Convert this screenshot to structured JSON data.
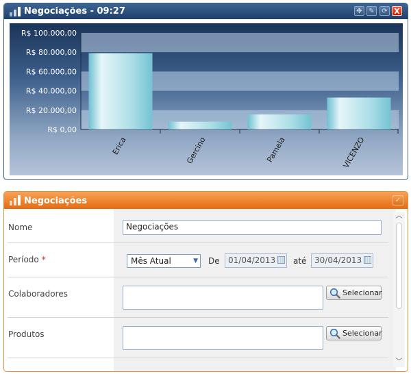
{
  "chart_widget": {
    "title": "Negociações - 09:27",
    "buttons": [
      "move-icon",
      "edit-icon",
      "refresh-icon",
      "close-icon"
    ],
    "close_label": "X"
  },
  "chart_data": {
    "type": "bar",
    "title": "",
    "categories": [
      "Erica",
      "Gercino",
      "Pamela",
      "VICENZO"
    ],
    "values": [
      79000,
      8000,
      15500,
      33000
    ],
    "ylim": [
      0,
      100000
    ],
    "yticks": [
      0,
      20000,
      40000,
      60000,
      80000,
      100000
    ],
    "ytick_labels": [
      "R$ 0,00",
      "R$ 20.000,00",
      "R$ 40.000,00",
      "R$ 60.000,00",
      "R$ 80.000,00",
      "R$ 100.000,00"
    ],
    "xlabel": "",
    "ylabel": "",
    "bar_color": "#7cc6d6",
    "grid": true
  },
  "form_widget": {
    "title": "Negociações",
    "fields": {
      "nome": {
        "label": "Nome",
        "value": "Negociações"
      },
      "periodo": {
        "label": "Período",
        "required_mark": "*",
        "select_value": "Mês Atual",
        "de_label": "De",
        "date_from": "01/04/2013",
        "ate_label": "até",
        "date_to": "30/04/2013"
      },
      "colaboradores": {
        "label": "Colaboradores",
        "value": "",
        "button": "Selecionar"
      },
      "produtos": {
        "label": "Produtos",
        "value": "",
        "button": "Selecionar"
      }
    },
    "scroll": {
      "up": "︿",
      "down": "﹀"
    }
  },
  "colors": {
    "chart_header": "#2a4d7c",
    "form_header": "#ef7d25",
    "required": "#d22020"
  }
}
